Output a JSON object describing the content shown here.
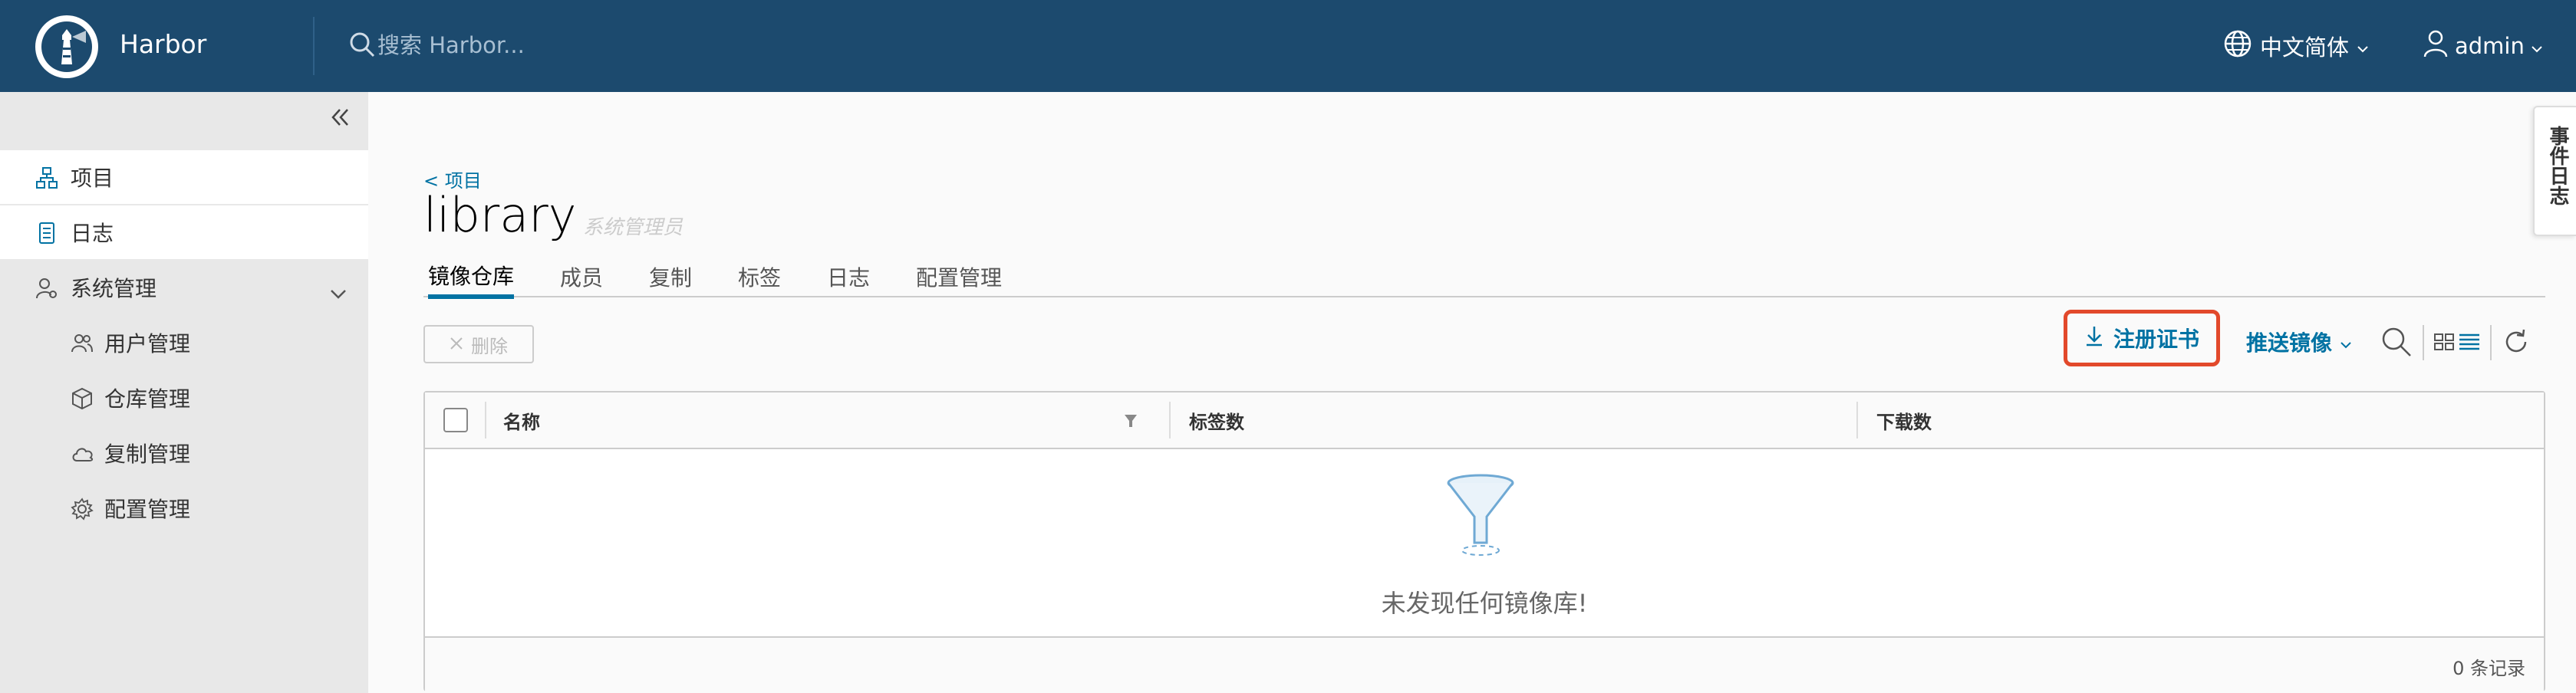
{
  "header": {
    "brand": "Harbor",
    "search_placeholder": "搜索 Harbor...",
    "language": "中文简体",
    "user": "admin"
  },
  "sidebar": {
    "items": [
      {
        "label": "项目",
        "icon": "projects-icon"
      },
      {
        "label": "日志",
        "icon": "logs-icon"
      },
      {
        "label": "系统管理",
        "icon": "admin-icon"
      }
    ],
    "sub_items": [
      {
        "label": "用户管理",
        "icon": "users-icon"
      },
      {
        "label": "仓库管理",
        "icon": "box-icon"
      },
      {
        "label": "复制管理",
        "icon": "cloud-icon"
      },
      {
        "label": "配置管理",
        "icon": "gear-icon"
      }
    ]
  },
  "page": {
    "back_link": "< 项目",
    "title": "library",
    "role": "系统管理员",
    "tabs": [
      "镜像仓库",
      "成员",
      "复制",
      "标签",
      "日志",
      "配置管理"
    ],
    "active_tab": 0
  },
  "toolbar": {
    "delete": "删除",
    "register_cert": "注册证书",
    "push_image": "推送镜像"
  },
  "table": {
    "columns": [
      "名称",
      "标签数",
      "下载数"
    ],
    "empty_message": "未发现任何镜像库!",
    "footer": "0 条记录"
  },
  "event_log": "事件日志",
  "colors": {
    "header_bg": "#1c4a6e",
    "accent": "#0072a3",
    "highlight": "#e2492b"
  }
}
